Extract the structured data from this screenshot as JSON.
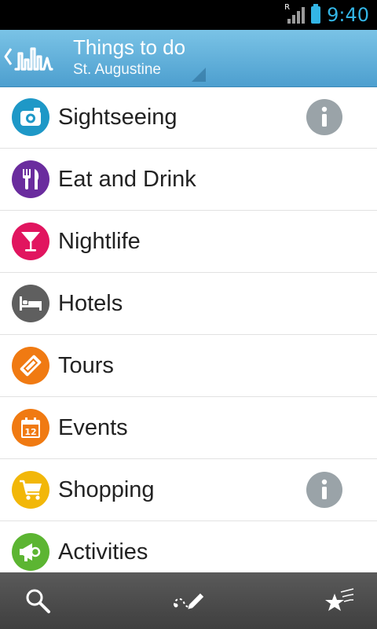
{
  "status_bar": {
    "time": "9:40",
    "roaming_indicator": "R",
    "icons": [
      "signal-icon",
      "battery-icon"
    ]
  },
  "action_bar": {
    "title": "Things to do",
    "subtitle": "St. Augustine",
    "logo_icon": "city-skyline-logo-icon",
    "back_icon": "chevron-left-icon"
  },
  "categories": [
    {
      "label": "Sightseeing",
      "icon": "camera-icon",
      "color": "#1e98c7",
      "has_info": true
    },
    {
      "label": "Eat and Drink",
      "icon": "fork-knife-icon",
      "color": "#6a2c9e",
      "has_info": false
    },
    {
      "label": "Nightlife",
      "icon": "cocktail-icon",
      "color": "#e1155f",
      "has_info": false
    },
    {
      "label": "Hotels",
      "icon": "bed-icon",
      "color": "#5f5f5f",
      "has_info": false
    },
    {
      "label": "Tours",
      "icon": "ticket-icon",
      "color": "#f07a12",
      "has_info": false
    },
    {
      "label": "Events",
      "icon": "calendar-icon",
      "color": "#f07a12",
      "has_info": false,
      "calendar_day": "12"
    },
    {
      "label": "Shopping",
      "icon": "shopping-cart-icon",
      "color": "#f2b709",
      "has_info": true
    },
    {
      "label": "Activities",
      "icon": "megaphone-icon",
      "color": "#5cb532",
      "has_info": false
    }
  ],
  "info_icon": "info-icon",
  "bottom_bar": {
    "buttons": [
      "search-icon",
      "route-pencil-icon",
      "favorites-stars-icon"
    ]
  },
  "colors": {
    "accent": "#33b5e5",
    "action_bar": "#5aa9d8",
    "bottom_bar": "#4a4a4a",
    "info_badge": "#9aa3a8"
  }
}
